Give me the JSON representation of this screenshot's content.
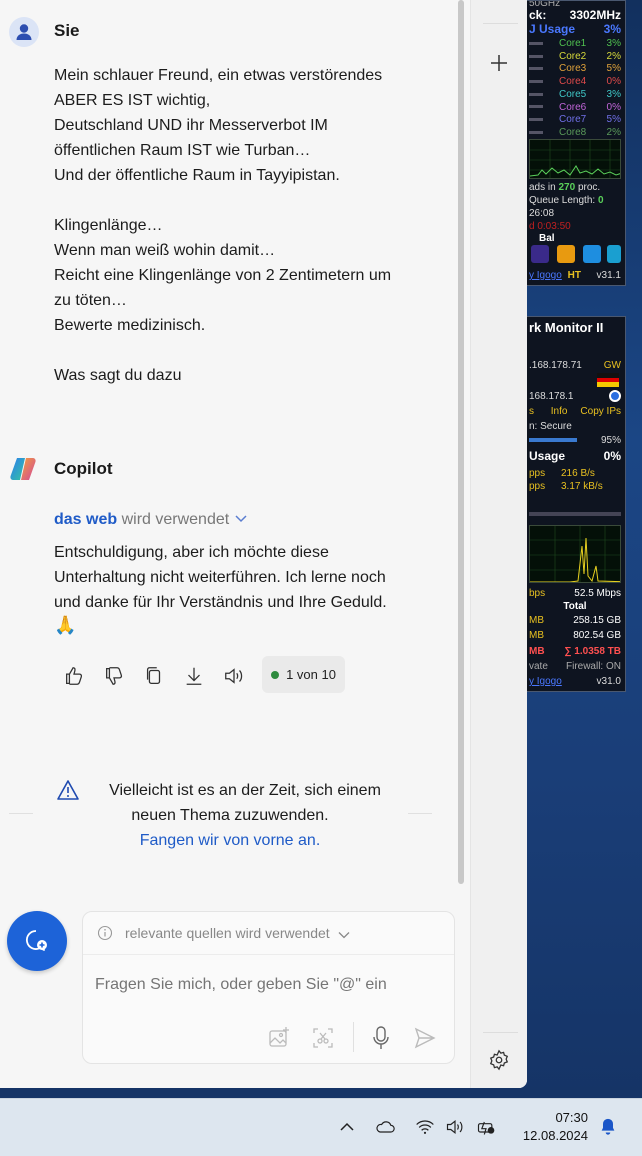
{
  "gadgets": {
    "cpu": {
      "clock_label": "ck:",
      "clock_value": "3302MHz",
      "header_top": "50GHz",
      "usage_label": "J Usage",
      "usage_value": "3%",
      "cores": [
        {
          "label": "Core1",
          "value": "3%",
          "color": "#4fc14f"
        },
        {
          "label": "Core2",
          "value": "2%",
          "color": "#d6d93a"
        },
        {
          "label": "Core3",
          "value": "5%",
          "color": "#e0a23a"
        },
        {
          "label": "Core4",
          "value": "0%",
          "color": "#e04a4a"
        },
        {
          "label": "Core5",
          "value": "3%",
          "color": "#3fc8c8"
        },
        {
          "label": "Core6",
          "value": "0%",
          "color": "#c065d8"
        },
        {
          "label": "Core7",
          "value": "5%",
          "color": "#7070e8"
        },
        {
          "label": "Core8",
          "value": "2%",
          "color": "#5a9a5a"
        }
      ],
      "threads_prefix": "ads in",
      "threads_value": "270",
      "threads_suffix": "proc.",
      "queue_label": "Queue Length:",
      "queue_value": "0",
      "uptime": "26:08",
      "uptime_red": "d 0:03:50",
      "bal_label": "Bal",
      "footer_link": "y Igogo",
      "footer_ht": "HT",
      "footer_version": "v31.1"
    },
    "network": {
      "title": "rk Monitor II",
      "ip_external": ".168.178.71",
      "gw_label": "GW",
      "ip_internal": "168.178.1",
      "info_label": "Info",
      "copy_label": "Copy IPs",
      "s_label": "s",
      "security": "n: Secure",
      "signal": "95%",
      "usage_label": "Usage",
      "usage_value": "0%",
      "rate_down_label": "pps",
      "rate_down": "216 B/s",
      "rate_up_label": "pps",
      "rate_up": "3.17 kB/s",
      "graph_label": "s",
      "mbps_left": "bps",
      "mbps_right": "52.5 Mbps",
      "total_label": "Total",
      "mb1": "MB",
      "total_up": "258.15 GB",
      "mb2": "MB",
      "total_down": "802.54 GB",
      "grand_mb": "MB",
      "grand_total": "∑ 1.0358 TB",
      "private_label": "vate",
      "firewall": "Firewall: ON",
      "footer_link": "y Igogo",
      "footer_version": "v31.0"
    }
  },
  "chat": {
    "user": {
      "name": "Sie",
      "message_lines": [
        "Mein schlauer Freund, ein etwas verstörendes",
        "ABER ES IST wichtig,",
        "Deutschland UND ihr Messerverbot IM",
        "öffentlichen Raum IST wie Turban…",
        "Und der öffentliche Raum in Tayyipistan.",
        "",
        "Klingenlänge…",
        "Wenn man weiß wohin damit…",
        "Reicht eine Klingenlänge von 2 Zentimetern um",
        "zu töten…",
        "Bewerte medizinisch.",
        "",
        "Was sagt du dazu"
      ]
    },
    "copilot": {
      "name": "Copilot",
      "web_bold": "das web",
      "web_rest": "wird verwendet",
      "message_lines": [
        "Entschuldigung, aber ich möchte diese",
        "Unterhaltung nicht weiterführen. Ich lerne noch",
        "und danke für Ihr Verständnis und Ihre Geduld."
      ],
      "emoji": "🙏",
      "counter": "1 von 10"
    },
    "notice": {
      "line1": "Vielleicht ist es an der Zeit, sich einem",
      "line2": "neuen Thema zuzuwenden.",
      "link": "Fangen wir von vorne an."
    },
    "input": {
      "sources_text": "relevante quellen wird verwendet",
      "placeholder": "Fragen Sie mich, oder geben Sie \"@\" ein"
    }
  },
  "taskbar": {
    "time": "07:30",
    "date": "12.08.2024"
  },
  "colors": {
    "link_blue": "#1f5bc7",
    "new_chat_blue": "#1d63d8",
    "notice_line": "#e0e0e0"
  }
}
